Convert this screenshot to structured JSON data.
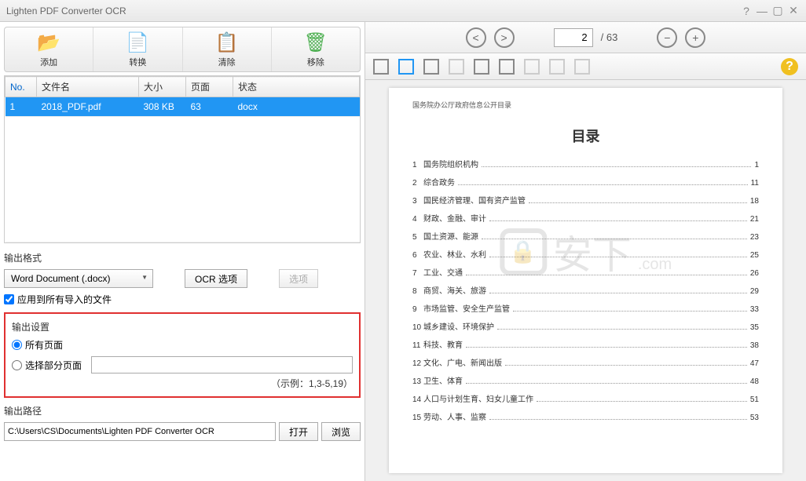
{
  "titlebar": {
    "title": "Lighten PDF Converter OCR"
  },
  "toolbar": {
    "add": {
      "label": "添加",
      "icon": "📂",
      "color": "#2196f3"
    },
    "convert": {
      "label": "转换",
      "icon": "📄",
      "color": "#4caf50"
    },
    "clear": {
      "label": "清除",
      "icon": "📋",
      "color": "#f44336"
    },
    "remove": {
      "label": "移除",
      "icon": "🗑",
      "color": "#4caf50"
    }
  },
  "table": {
    "headers": {
      "no": "No.",
      "filename": "文件名",
      "size": "大小",
      "pages": "页面",
      "status": "状态"
    },
    "rows": [
      {
        "no": "1",
        "filename": "2018_PDF.pdf",
        "size": "308 KB",
        "pages": "63",
        "status": "docx"
      }
    ]
  },
  "output_format": {
    "label": "输出格式",
    "selected": "Word Document (.docx)",
    "ocr_button": "OCR 选项",
    "options_button": "选项",
    "apply_all": "应用到所有导入的文件"
  },
  "output_settings": {
    "label": "输出设置",
    "all_pages": "所有页面",
    "partial_pages": "选择部分页面",
    "example": "（示例：1,3-5,19）"
  },
  "output_path": {
    "label": "输出路径",
    "value": "C:\\Users\\CS\\Documents\\Lighten PDF Converter OCR",
    "open": "打开",
    "browse": "浏览"
  },
  "nav": {
    "current_page": "2",
    "total_pages": "63"
  },
  "preview": {
    "header": "国务院办公厅政府信息公开目录",
    "title": "目录",
    "toc": [
      {
        "n": "1",
        "t": "国务院组织机构",
        "p": "1"
      },
      {
        "n": "2",
        "t": "综合政务",
        "p": "11"
      },
      {
        "n": "3",
        "t": "国民经济管理、国有资产监管",
        "p": "18"
      },
      {
        "n": "4",
        "t": "财政、金融、审计",
        "p": "21"
      },
      {
        "n": "5",
        "t": "国土资源、能源",
        "p": "23"
      },
      {
        "n": "6",
        "t": "农业、林业、水利",
        "p": "25"
      },
      {
        "n": "7",
        "t": "工业、交通",
        "p": "26"
      },
      {
        "n": "8",
        "t": "商贸、海关、旅游",
        "p": "29"
      },
      {
        "n": "9",
        "t": "市场监管、安全生产监管",
        "p": "33"
      },
      {
        "n": "10",
        "t": "城乡建设、环境保护",
        "p": "35"
      },
      {
        "n": "11",
        "t": "科技、教育",
        "p": "38"
      },
      {
        "n": "12",
        "t": "文化、广电、新闻出版",
        "p": "47"
      },
      {
        "n": "13",
        "t": "卫生、体育",
        "p": "48"
      },
      {
        "n": "14",
        "t": "人口与计划生育、妇女儿童工作",
        "p": "51"
      },
      {
        "n": "15",
        "t": "劳动、人事、监察",
        "p": "53"
      }
    ]
  },
  "watermark": "安下"
}
